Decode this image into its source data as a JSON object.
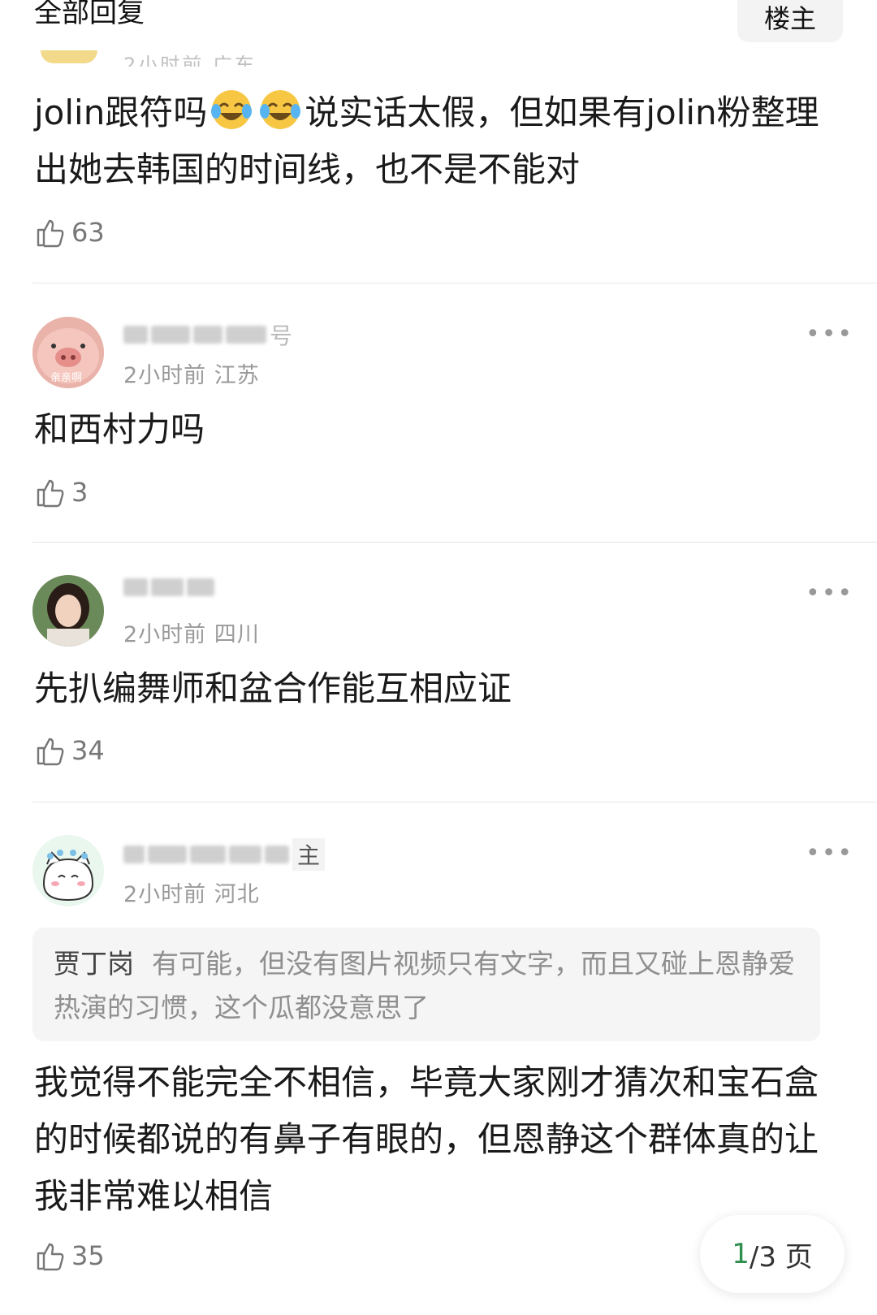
{
  "header": {
    "title": "全部回复",
    "op_tab": "楼主"
  },
  "comments": [
    {
      "text_before_emoji": "jolin跟符吗",
      "text_after_emoji": "说实话太假，但如果有jolin粉整理出她去韩国的时间线，也不是不能对",
      "likes": "63"
    },
    {
      "username_visible": "号",
      "time": "2小时前",
      "location": "江苏",
      "avatar_caption": "亲亲啊",
      "text": "和西村力吗",
      "likes": "3"
    },
    {
      "username_visible": "",
      "time": "2小时前",
      "location": "四川",
      "text": "先扒编舞师和盆合作能互相应证",
      "likes": "34"
    },
    {
      "username_visible": "主",
      "time": "2小时前",
      "location": "河北",
      "quote_author": "贾丁岗",
      "quote_text": "有可能，但没有图片视频只有文字，而且又碰上恩静爱热演的习惯，这个瓜都没意思了",
      "text": "我觉得不能完全不相信，毕竟大家刚才猜次和宝石盒的时候都说的有鼻子有眼的，但恩静这个群体真的让我非常难以相信",
      "likes": "35"
    }
  ],
  "more_icon": "•••",
  "pagination": {
    "current": "1",
    "total_label": "/3 页"
  }
}
